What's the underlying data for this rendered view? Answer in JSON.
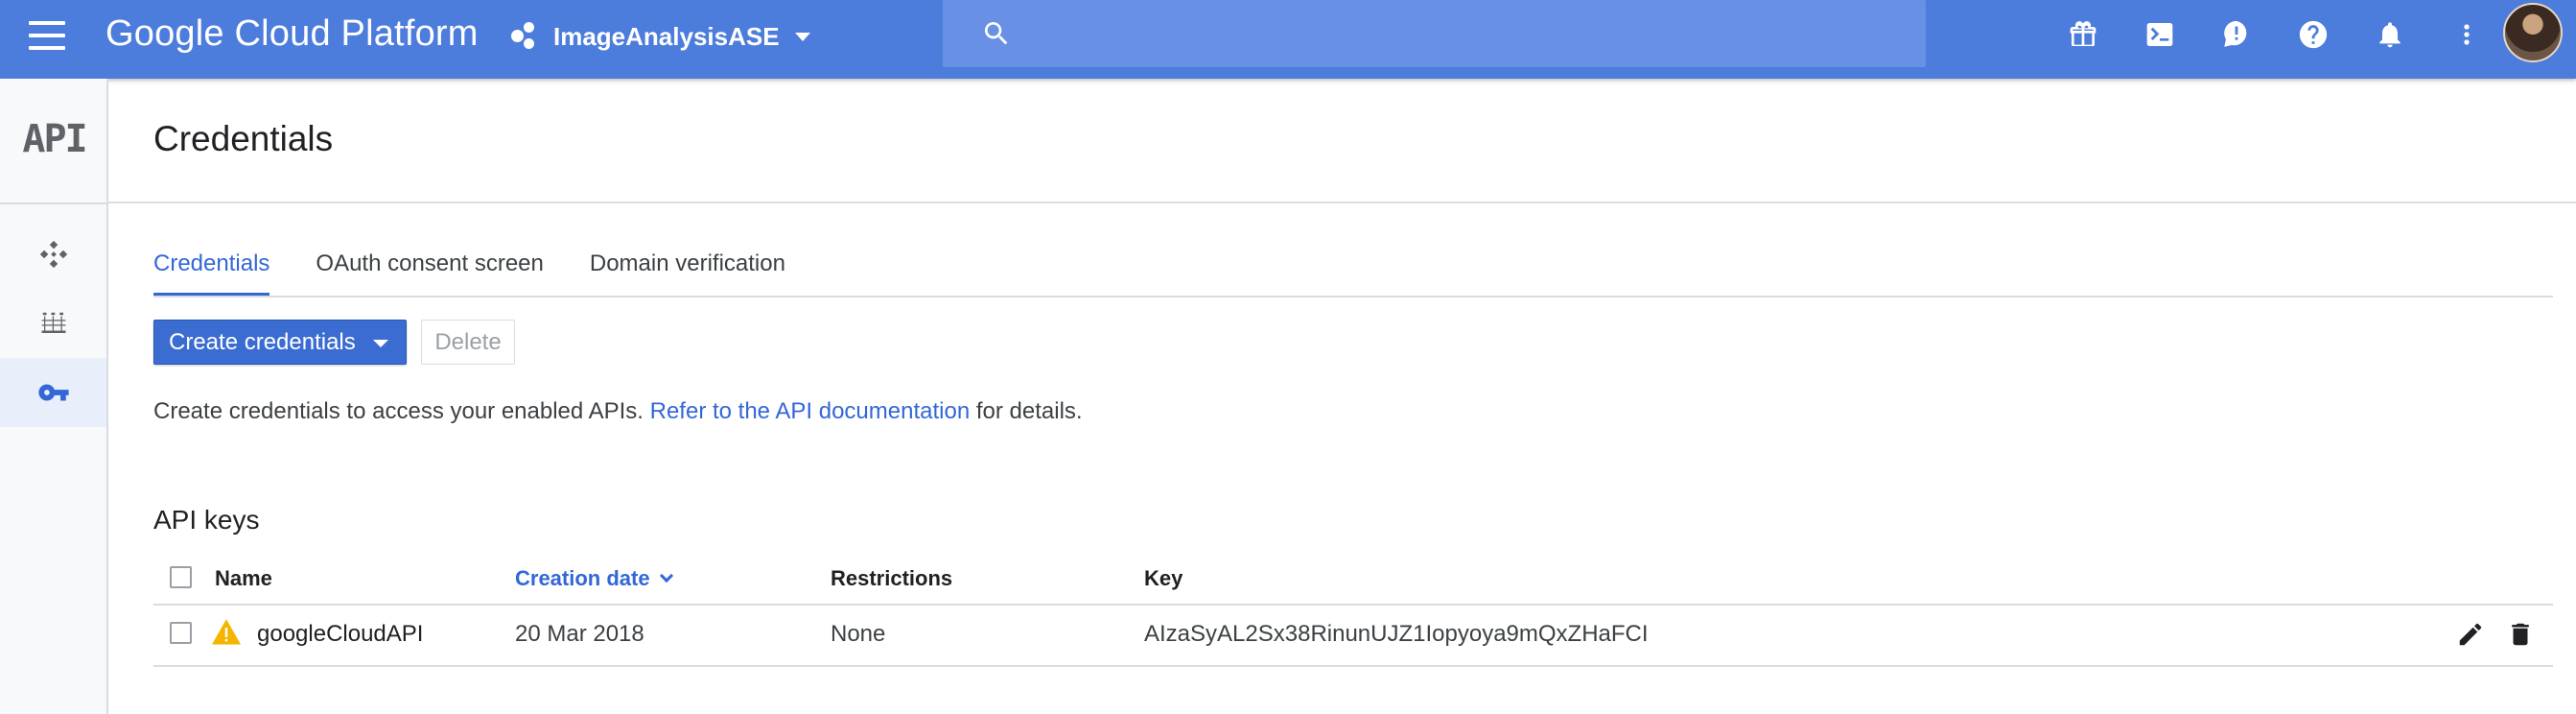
{
  "topbar": {
    "brand": "Google Cloud Platform",
    "project": "ImageAnalysisASE",
    "search_placeholder": "",
    "icons": [
      "gift-icon",
      "cloud-shell-icon",
      "feedback-icon",
      "help-icon",
      "notifications-icon",
      "more-vert-icon"
    ]
  },
  "leftnav": {
    "logo": "API",
    "items": [
      {
        "icon": "dashboard-icon",
        "active": false
      },
      {
        "icon": "library-icon",
        "active": false
      },
      {
        "icon": "key-icon",
        "active": true
      }
    ]
  },
  "page": {
    "title": "Credentials"
  },
  "tabs": [
    {
      "label": "Credentials",
      "active": true
    },
    {
      "label": "OAuth consent screen",
      "active": false
    },
    {
      "label": "Domain verification",
      "active": false
    }
  ],
  "actions": {
    "create_label": "Create credentials",
    "delete_label": "Delete"
  },
  "info": {
    "before": "Create credentials to access your enabled APIs.",
    "link": "Refer to the API documentation",
    "after": "for details."
  },
  "api_keys": {
    "title": "API keys",
    "columns": [
      "Name",
      "Creation date",
      "Restrictions",
      "Key"
    ],
    "rows": [
      {
        "name": "googleCloudAPI",
        "created": "20 Mar 2018",
        "restrictions": "None",
        "key": "AIzaSyAL2Sx38RinunUJZ1Iopyoya9mQxZHaFCI"
      }
    ]
  },
  "colors": {
    "topbar": "#4c7cdc",
    "accent": "#3367d6",
    "warning": "#f4b400"
  }
}
